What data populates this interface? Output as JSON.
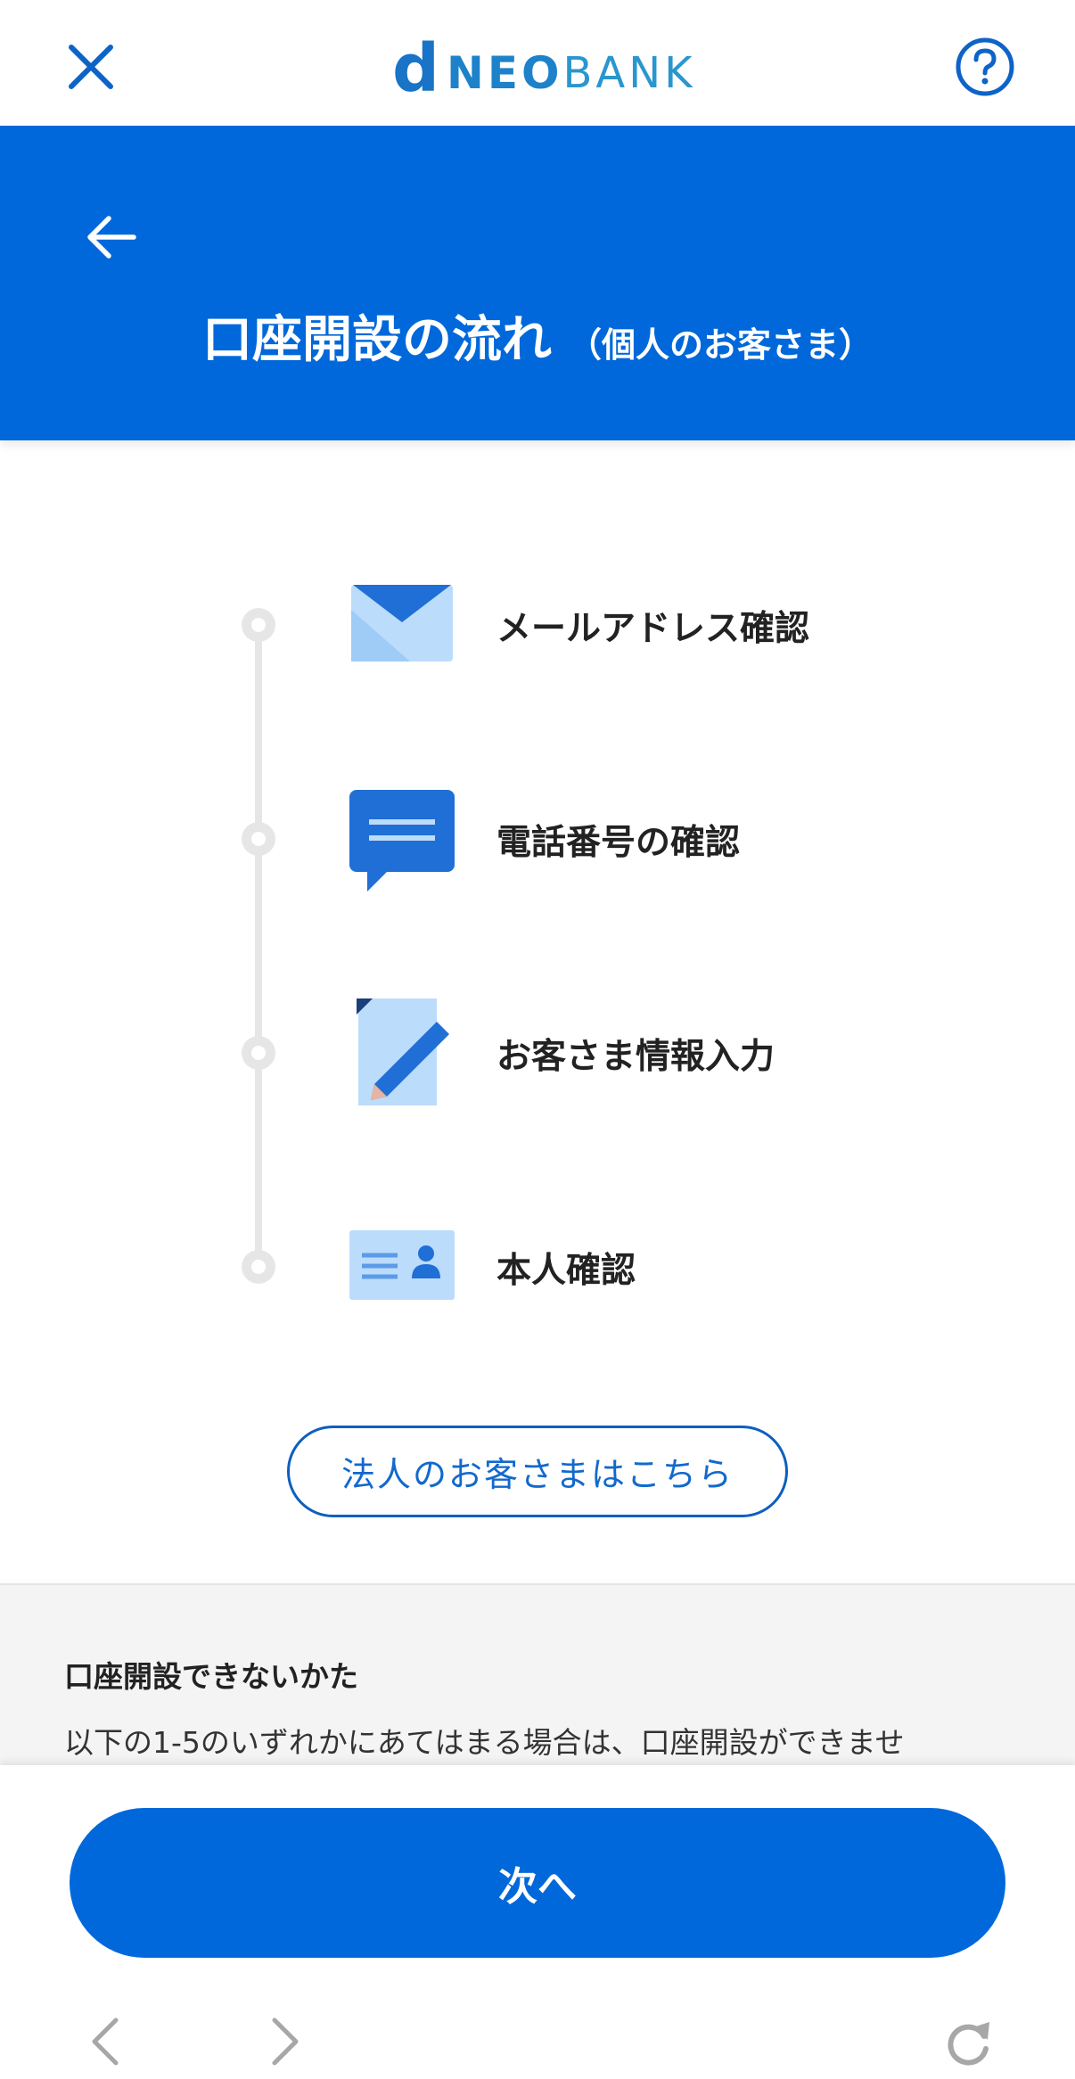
{
  "header": {
    "logo_d": "d",
    "logo_neo": "NEO",
    "logo_bank": "BANK"
  },
  "banner": {
    "title_main": "口座開設の流れ",
    "title_sub": "（個人のお客さま）"
  },
  "steps": [
    {
      "label": "メールアドレス確認",
      "icon": "envelope-icon"
    },
    {
      "label": "電話番号の確認",
      "icon": "chat-bubble-icon"
    },
    {
      "label": "お客さま情報入力",
      "icon": "document-pencil-icon"
    },
    {
      "label": "本人確認",
      "icon": "id-card-icon"
    }
  ],
  "corporate_button": "法人のお客さまはこちら",
  "info": {
    "title": "口座開設できないかた",
    "text": "以下の1-5のいずれかにあてはまる場合は、口座開設ができませ"
  },
  "footer": {
    "next_label": "次へ"
  },
  "colors": {
    "primary": "#0068da",
    "icon_dark": "#1f6fd6",
    "icon_light": "#bcdcfb"
  }
}
